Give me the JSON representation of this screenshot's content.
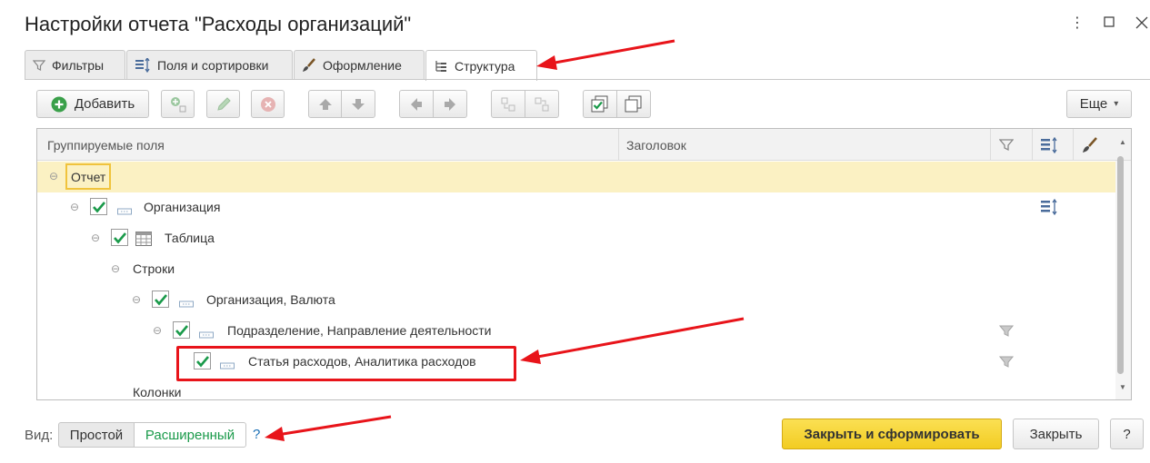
{
  "window": {
    "title": "Настройки отчета \"Расходы организаций\"",
    "controls": [
      "more-vertical-icon",
      "maximize-icon",
      "close-icon"
    ]
  },
  "tabs": [
    {
      "label": "Фильтры",
      "icon": "filter-icon"
    },
    {
      "label": "Поля и сортировки",
      "icon": "fields-sort-icon"
    },
    {
      "label": "Оформление",
      "icon": "brush-icon"
    },
    {
      "label": "Структура",
      "icon": "structure-icon",
      "active": true
    }
  ],
  "toolbar": {
    "add_label": "Добавить",
    "more_label": "Еще",
    "more_arrow": "▾"
  },
  "grid": {
    "columns": {
      "grouped_fields": "Группируемые поля",
      "header": "Заголовок"
    },
    "rows": [
      {
        "label": "Отчет",
        "level": 0,
        "selected": true
      },
      {
        "label": "Организация",
        "level": 1,
        "checked": true,
        "icon": "grouping-icon",
        "sort_marker": true
      },
      {
        "label": "Таблица",
        "level": 2,
        "checked": true,
        "icon": "table-icon"
      },
      {
        "label": "Строки",
        "level": 3
      },
      {
        "label": "Организация, Валюта",
        "level": 4,
        "checked": true,
        "icon": "grouping-icon"
      },
      {
        "label": "Подразделение, Направление деятельности",
        "level": 5,
        "checked": true,
        "icon": "grouping-icon",
        "filter_marker": true
      },
      {
        "label": "Статья расходов, Аналитика расходов",
        "level": 6,
        "checked": true,
        "icon": "grouping-icon",
        "filter_marker": true,
        "highlighted": true
      },
      {
        "label": "Колонки",
        "level": 3
      }
    ]
  },
  "footer": {
    "view_label": "Вид:",
    "view_simple": "Простой",
    "view_extended": "Расширенный",
    "help_link": "?",
    "close_and_generate": "Закрыть и сформировать",
    "close": "Закрыть",
    "help_button": "?"
  },
  "colors": {
    "accent_yellow": "#f7d430",
    "check_green": "#1a9a4a",
    "annotation_red": "#e8141a",
    "selected_row": "#fbf1c3"
  }
}
